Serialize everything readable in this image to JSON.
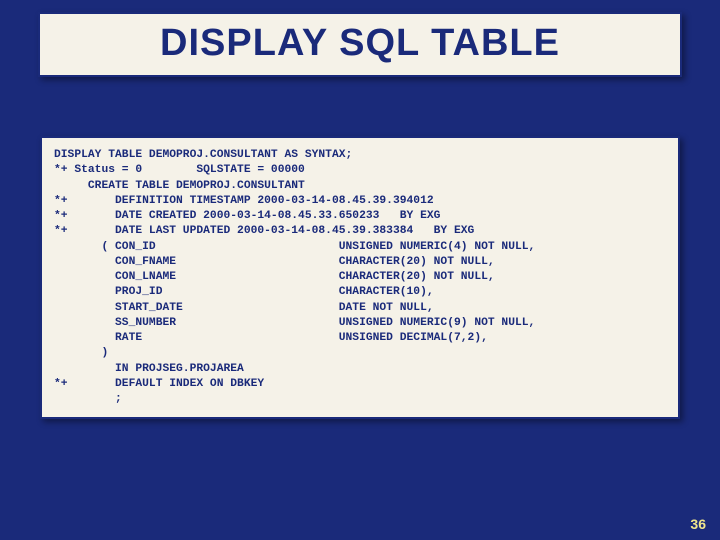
{
  "slide": {
    "title": "DISPLAY SQL TABLE",
    "page_number": "36",
    "code": "DISPLAY TABLE DEMOPROJ.CONSULTANT AS SYNTAX;\n*+ Status = 0        SQLSTATE = 00000\n     CREATE TABLE DEMOPROJ.CONSULTANT\n*+       DEFINITION TIMESTAMP 2000-03-14-08.45.39.394012\n*+       DATE CREATED 2000-03-14-08.45.33.650233   BY EXG\n*+       DATE LAST UPDATED 2000-03-14-08.45.39.383384   BY EXG\n       ( CON_ID                           UNSIGNED NUMERIC(4) NOT NULL,\n         CON_FNAME                        CHARACTER(20) NOT NULL,\n         CON_LNAME                        CHARACTER(20) NOT NULL,\n         PROJ_ID                          CHARACTER(10),\n         START_DATE                       DATE NOT NULL,\n         SS_NUMBER                        UNSIGNED NUMERIC(9) NOT NULL,\n         RATE                             UNSIGNED DECIMAL(7,2),\n       )\n         IN PROJSEG.PROJAREA\n*+       DEFAULT INDEX ON DBKEY\n         ;"
  }
}
